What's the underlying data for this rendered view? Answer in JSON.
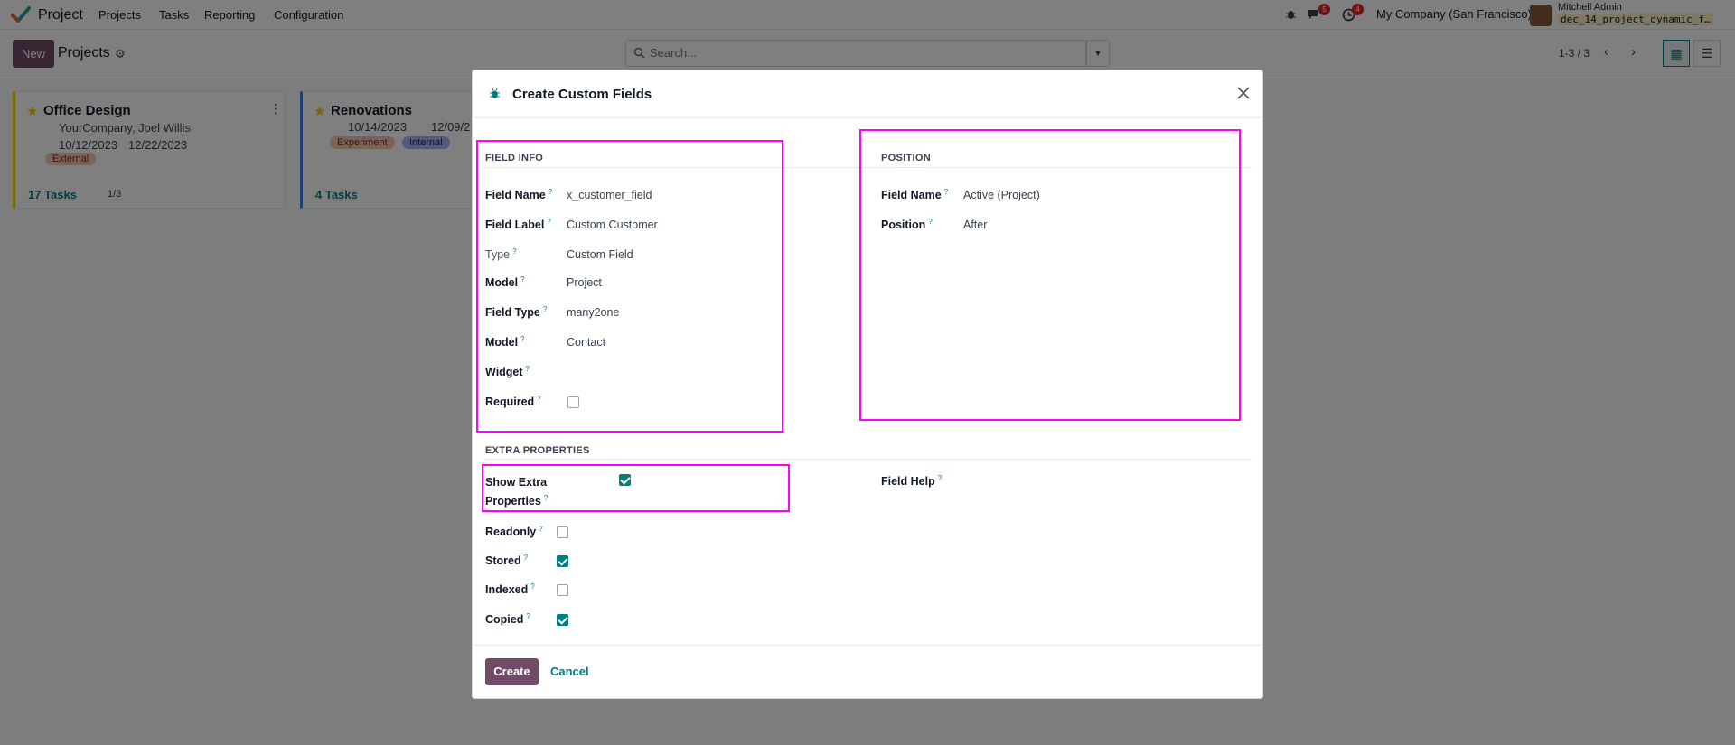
{
  "navbar": {
    "app_name": "Project",
    "menu": [
      "Projects",
      "Tasks",
      "Reporting",
      "Configuration"
    ],
    "chat_badge": "5",
    "activity_badge": "4",
    "company": "My Company (San Francisco)",
    "user_name": "Mitchell Admin",
    "database": "dec_14_project_dynamic_f…"
  },
  "control": {
    "new_label": "New",
    "title": "Projects",
    "search_placeholder": "Search...",
    "pager": "1-3 / 3"
  },
  "kanban": {
    "cards": [
      {
        "name": "Office Design",
        "customer": "YourCompany, Joel Willis",
        "date_start": "10/12/2023",
        "date_end": "12/22/2023",
        "tags": [
          "External"
        ],
        "tasks": "17 Tasks",
        "milestones": "1/3"
      },
      {
        "name": "Renovations",
        "date_start": "10/14/2023",
        "date_end": "12/09/2…",
        "tags": [
          "Experiment",
          "Internal"
        ],
        "tasks": "4 Tasks"
      }
    ]
  },
  "dialog": {
    "title": "Create Custom Fields",
    "field_info": {
      "heading": "FIELD INFO",
      "rows": [
        {
          "label": "Field Name",
          "value": "x_customer_field"
        },
        {
          "label": "Field Label",
          "value": "Custom Customer"
        },
        {
          "label": "Type",
          "value": "Custom Field"
        },
        {
          "label": "Model",
          "value": "Project"
        },
        {
          "label": "Field Type",
          "value": "many2one"
        },
        {
          "label": "Model",
          "value": "Contact"
        },
        {
          "label": "Widget",
          "value": ""
        },
        {
          "label": "Required",
          "value": ""
        }
      ],
      "required_checked": false
    },
    "position": {
      "heading": "POSITION",
      "rows": [
        {
          "label": "Field Name",
          "value": "Active (Project)"
        },
        {
          "label": "Position",
          "value": "After"
        }
      ]
    },
    "extra": {
      "heading": "EXTRA PROPERTIES",
      "show_extra_label_1": "Show Extra",
      "show_extra_label_2": "Properties",
      "show_extra_checked": true,
      "field_help_label": "Field Help",
      "checks": [
        {
          "label": "Readonly",
          "checked": false
        },
        {
          "label": "Stored",
          "checked": true
        },
        {
          "label": "Indexed",
          "checked": false
        },
        {
          "label": "Copied",
          "checked": true
        }
      ]
    },
    "footer": {
      "create_label": "Create",
      "cancel_label": "Cancel"
    }
  },
  "colors": {
    "primary": "#714b67",
    "accent": "#017e84",
    "highlight": "#ff00ff"
  }
}
